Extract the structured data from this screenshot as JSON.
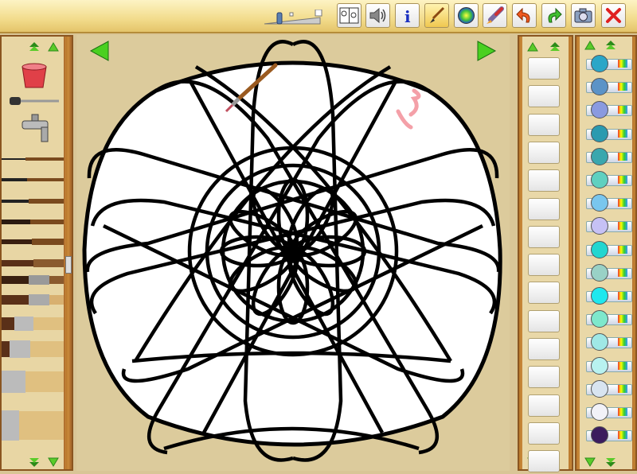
{
  "toolbar": {
    "icons": [
      "zoom-slider",
      "gallery-icon",
      "sound-icon",
      "info-icon",
      "brush-tool-icon",
      "color-wheel-icon",
      "spray-rocket-icon",
      "undo-icon",
      "redo-icon",
      "camera-icon",
      "close-icon"
    ],
    "zoom_level": 0.3
  },
  "palette_colors": [
    "#2aa6c8",
    "#5b93c7",
    "#8a9ae0",
    "#2a9ab0",
    "#3aa7ae",
    "#5fd0c0",
    "#79c6ee",
    "#c6c1f5",
    "#22d6d0",
    "#99d1c6",
    "#1fe8ee",
    "#7ee8cc",
    "#9fe8e6",
    "#b8f2f0",
    "#d8e4f0",
    "#f2f2f8",
    "#3b1c5e"
  ],
  "brush_slots": 15,
  "colors": {
    "toolbar_bg": "#f2dc8c",
    "wood": "#c48437",
    "canvas_bg": "#dccb9c",
    "close_red": "#e02020"
  }
}
